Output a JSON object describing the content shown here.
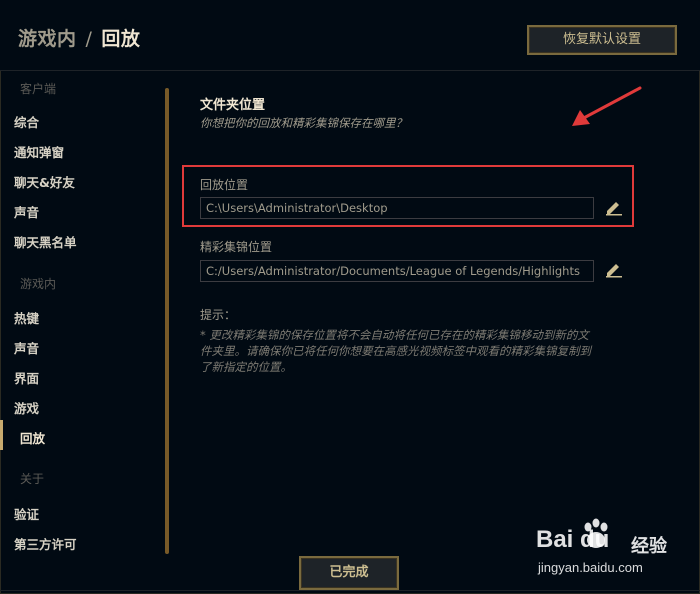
{
  "header": {
    "breadcrumb_parent": "游戏内",
    "breadcrumb_separator": "/",
    "breadcrumb_current": "回放",
    "reset_button_label": "恢复默认设置"
  },
  "sidebar": {
    "client_section": "客户端",
    "client_items": [
      "综合",
      "通知弹窗",
      "聊天&好友",
      "声音",
      "聊天黑名单"
    ],
    "ingame_section": "游戏内",
    "ingame_items": [
      "热键",
      "声音",
      "界面",
      "游戏",
      "回放"
    ],
    "active_item": "回放",
    "about_section": "关于",
    "about_items": [
      "验证",
      "第三方许可"
    ]
  },
  "content": {
    "folder_title": "文件夹位置",
    "folder_subtitle": "你想把你的回放和精彩集锦保存在哪里？",
    "replay_label": "回放位置",
    "replay_path": "C:\\Users\\Administrator\\Desktop",
    "highlights_label": "精彩集锦位置",
    "highlights_path": "C:/Users/Administrator/Documents/League of Legends/Highlights",
    "hint_title": "提示：",
    "hint_text": "* 更改精彩集锦的保存位置将不会自动将任何已存在的精彩集锦移动到新的文件夹里。请确保你已将任何你想要在高感光视频标签中观看的精彩集锦复制到了新指定的位置。"
  },
  "footer": {
    "done_button_label": "已完成"
  },
  "watermark": {
    "logo_text": "Bai du",
    "logo_zh": "经验",
    "url": "jingyan.baidu.com"
  },
  "colors": {
    "background": "#010a13",
    "gold": "#c8aa6e",
    "highlight_box": "#e03a3a",
    "arrow": "#e03a3a"
  },
  "icons": [
    "pencil-icon",
    "arrow-annotation",
    "baidu-paw-icon"
  ]
}
